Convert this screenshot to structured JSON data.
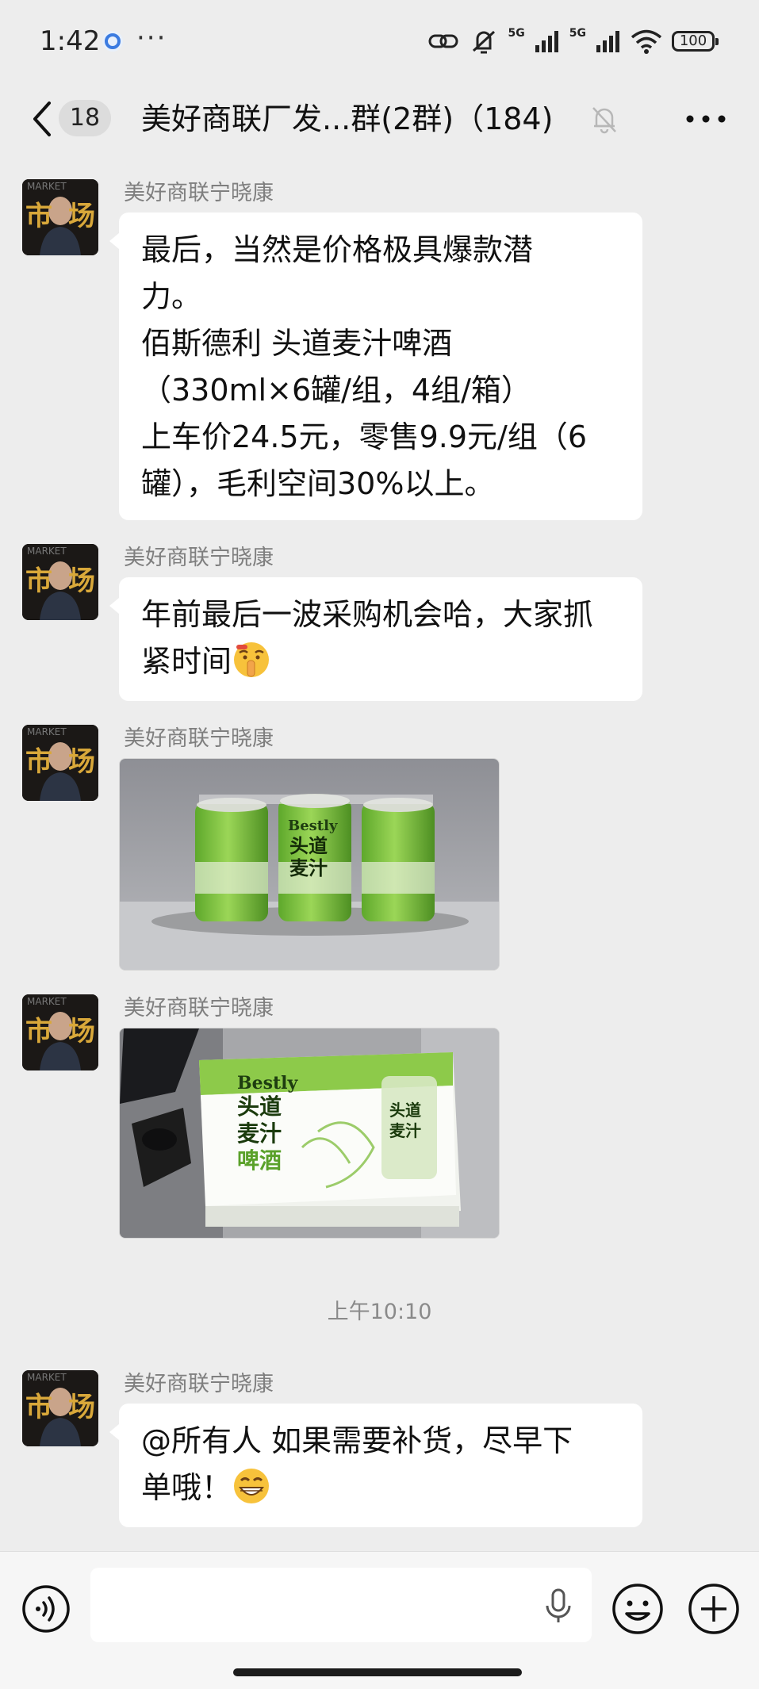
{
  "status_bar": {
    "time": "1:42",
    "more": "···",
    "network_5g_1": "5G",
    "network_5g_2": "5G",
    "battery": "100"
  },
  "nav": {
    "unread_count": "18",
    "title": "美好商联厂发...群(2群)（184)"
  },
  "messages": [
    {
      "sender": "美好商联宁晓康",
      "lines": [
        "最后，当然是价格极具爆款潜",
        "力。",
        "佰斯德利 头道麦汁啤酒",
        "（330ml×6罐/组，4组/箱）",
        "上车价24.5元，零售9.9元/组（6",
        "罐），毛利空间30%以上。"
      ]
    },
    {
      "sender": "美好商联宁晓康",
      "lines": [
        "年前最后一波采购机会哈，大家抓",
        "紧时间"
      ]
    },
    {
      "sender": "美好商联宁晓康",
      "photo": {
        "brand": "Bestly",
        "text_1": "头道",
        "text_2": "麦汁"
      }
    },
    {
      "sender": "美好商联宁晓康",
      "photo": {
        "brand": "Bestly",
        "text_1": "头道",
        "text_2": "麦汁",
        "text_3": "啤酒"
      }
    },
    {
      "sender": "美好商联宁晓康",
      "lines": [
        "@所有人  如果需要补货，尽早下",
        "单哦！"
      ]
    }
  ],
  "timestamp": "上午10:10",
  "avatar": {
    "top_text": "MARKET",
    "glyph_1": "市",
    "glyph_2": "场"
  },
  "icons": {
    "back": "chevron-left-icon",
    "mute": "bell-off-icon",
    "more": "more-horizontal-icon",
    "voice": "voice-icon",
    "mic": "mic-icon",
    "emoji": "emoji-icon",
    "plus": "plus-circle-icon"
  },
  "colors": {
    "background": "#ededed",
    "bubble": "#ffffff",
    "sender": "#7f7f7f",
    "can_green": "#7cc23a"
  }
}
